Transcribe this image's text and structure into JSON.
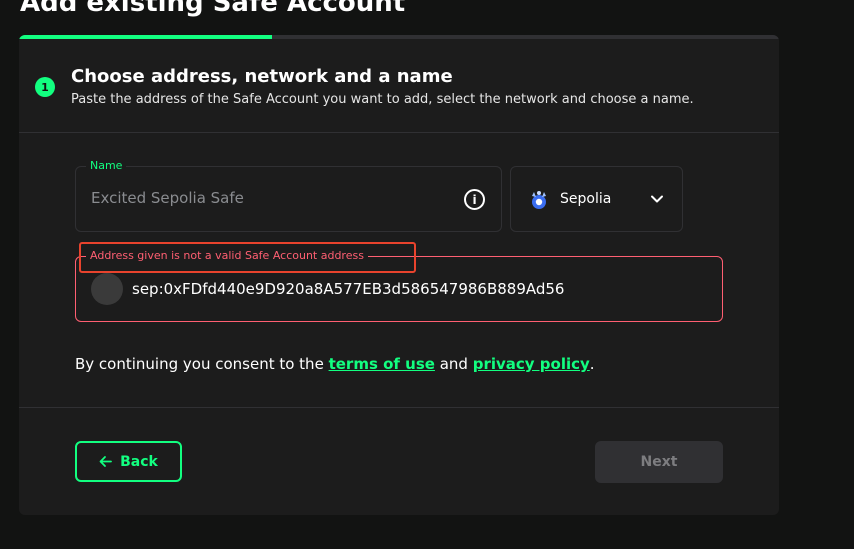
{
  "page": {
    "title": "Add existing Safe Account"
  },
  "progress": {
    "fraction": 0.333,
    "color": "#12ff80"
  },
  "step": {
    "number": "1",
    "title": "Choose address, network and a name",
    "subtitle": "Paste the address of the Safe Account you want to add, select the network and choose a name."
  },
  "name_field": {
    "label": "Name",
    "placeholder": "Excited Sepolia Safe",
    "value": "",
    "icon": "info-icon"
  },
  "network": {
    "selected": "Sepolia",
    "icon": "sepolia-logo-icon",
    "dropdown_icon": "chevron-down-icon"
  },
  "address_field": {
    "error": "Address given is not a valid Safe Account address",
    "value": "sep:0xFDfd440e9D920a8A577EB3d586547986B889Ad56",
    "error_color": "#ff5f72"
  },
  "consent": {
    "prefix": "By continuing you consent to the ",
    "terms_label": "terms of use",
    "middle": " and ",
    "privacy_label": "privacy policy",
    "suffix": "."
  },
  "actions": {
    "back_label": "Back",
    "next_label": "Next"
  },
  "colors": {
    "accent": "#12ff80",
    "background": "#121312",
    "card": "#1c1c1c",
    "border": "#303033",
    "highlight": "#e8432d"
  }
}
